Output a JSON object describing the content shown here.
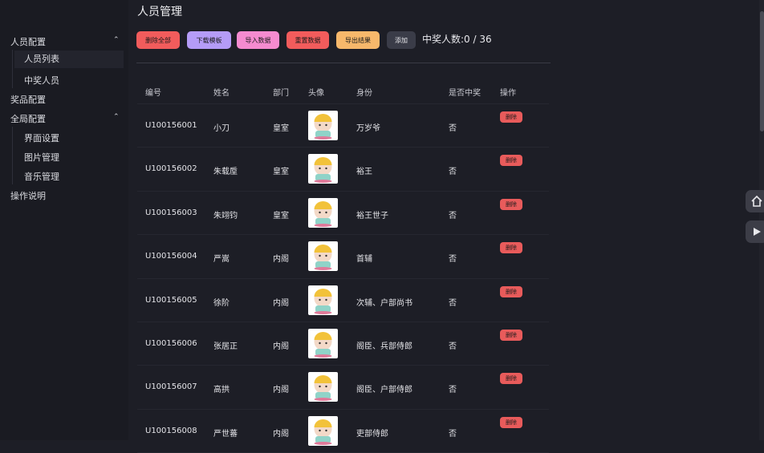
{
  "page_title": "人员管理",
  "sidebar": {
    "items": [
      {
        "label": "人员配置",
        "expanded": true
      },
      {
        "label": "人员列表",
        "active": true
      },
      {
        "label": "中奖人员"
      },
      {
        "label": "奖品配置"
      },
      {
        "label": "全局配置",
        "expanded": true
      },
      {
        "label": "界面设置"
      },
      {
        "label": "图片管理"
      },
      {
        "label": "音乐管理"
      },
      {
        "label": "操作说明"
      }
    ]
  },
  "toolbar": {
    "delete_all": "删除全部",
    "download_template": "下载模板",
    "import_data": "导入数据",
    "reset_data": "重置数据",
    "export_results": "导出结果",
    "add": "添加"
  },
  "summary": "中奖人数:0 / 36",
  "table": {
    "headers": [
      "编号",
      "姓名",
      "部门",
      "头像",
      "身份",
      "是否中奖",
      "操作"
    ],
    "rows": [
      {
        "id": "U100156001",
        "name": "小刀",
        "dept": "皇室",
        "identity": "万岁爷",
        "won": "否",
        "action": "删除"
      },
      {
        "id": "U100156002",
        "name": "朱载垕",
        "dept": "皇室",
        "identity": "裕王",
        "won": "否",
        "action": "删除"
      },
      {
        "id": "U100156003",
        "name": "朱翊钧",
        "dept": "皇室",
        "identity": "裕王世子",
        "won": "否",
        "action": "删除"
      },
      {
        "id": "U100156004",
        "name": "严嵩",
        "dept": "内阁",
        "identity": "首辅",
        "won": "否",
        "action": "删除"
      },
      {
        "id": "U100156005",
        "name": "徐阶",
        "dept": "内阁",
        "identity": "次辅、户部尚书",
        "won": "否",
        "action": "删除"
      },
      {
        "id": "U100156006",
        "name": "张居正",
        "dept": "内阁",
        "identity": "阁臣、兵部侍郎",
        "won": "否",
        "action": "删除"
      },
      {
        "id": "U100156007",
        "name": "高拱",
        "dept": "内阁",
        "identity": "阁臣、户部侍郎",
        "won": "否",
        "action": "删除"
      },
      {
        "id": "U100156008",
        "name": "严世蕃",
        "dept": "内阁",
        "identity": "吏部侍郎",
        "won": "否",
        "action": "删除"
      }
    ]
  },
  "colors": {
    "delete_all": "#f25c5c",
    "download_template": "#b59cf7",
    "import_data": "#f58bd0",
    "reset_data": "#f25c5c",
    "export_results": "#f7b86b",
    "add": "#3a3c48",
    "row_delete": "#e85b5b"
  },
  "icons": {
    "home": "home-icon",
    "play": "play-icon",
    "chevron_up": "chevron-up-icon"
  }
}
